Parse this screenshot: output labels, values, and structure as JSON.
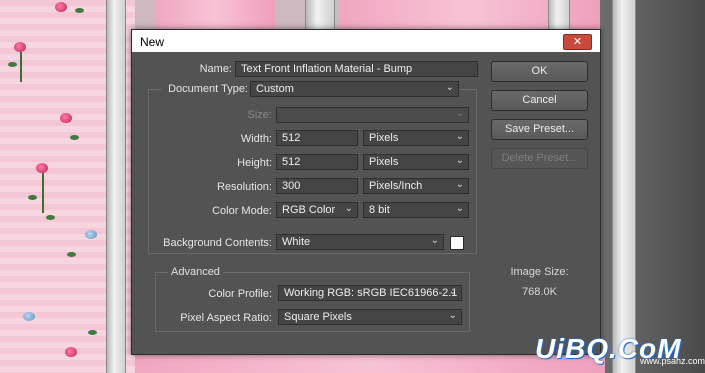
{
  "dialog": {
    "title": "New",
    "close_glyph": "✕",
    "name_label": "Name:",
    "name_value": "Text Front Inflation Material - Bump",
    "document_type_label": "Document Type:",
    "document_type_value": "Custom",
    "size_label": "Size:",
    "size_value": "",
    "width_label": "Width:",
    "width_value": "512",
    "width_unit": "Pixels",
    "height_label": "Height:",
    "height_value": "512",
    "height_unit": "Pixels",
    "resolution_label": "Resolution:",
    "resolution_value": "300",
    "resolution_unit": "Pixels/Inch",
    "color_mode_label": "Color Mode:",
    "color_mode_value": "RGB Color",
    "bit_depth_value": "8 bit",
    "background_label": "Background Contents:",
    "background_value": "White",
    "background_swatch_color": "#ffffff",
    "advanced_label": "Advanced",
    "color_profile_label": "Color Profile:",
    "color_profile_value": "Working RGB:  sRGB IEC61966-2.1",
    "pixel_aspect_label": "Pixel Aspect Ratio:",
    "pixel_aspect_value": "Square Pixels",
    "buttons": {
      "ok": "OK",
      "cancel": "Cancel",
      "save_preset": "Save Preset...",
      "delete_preset": "Delete Preset..."
    },
    "image_size_label": "Image Size:",
    "image_size_value": "768.0K"
  },
  "icons": {
    "dropdown": "⌄"
  },
  "watermark": {
    "text": "UiBQ.CoM",
    "subtext": "www.psahz.com"
  },
  "colors": {
    "dialog_bg": "#535353",
    "field_bg": "#454545",
    "close_button": "#c74a3c"
  }
}
